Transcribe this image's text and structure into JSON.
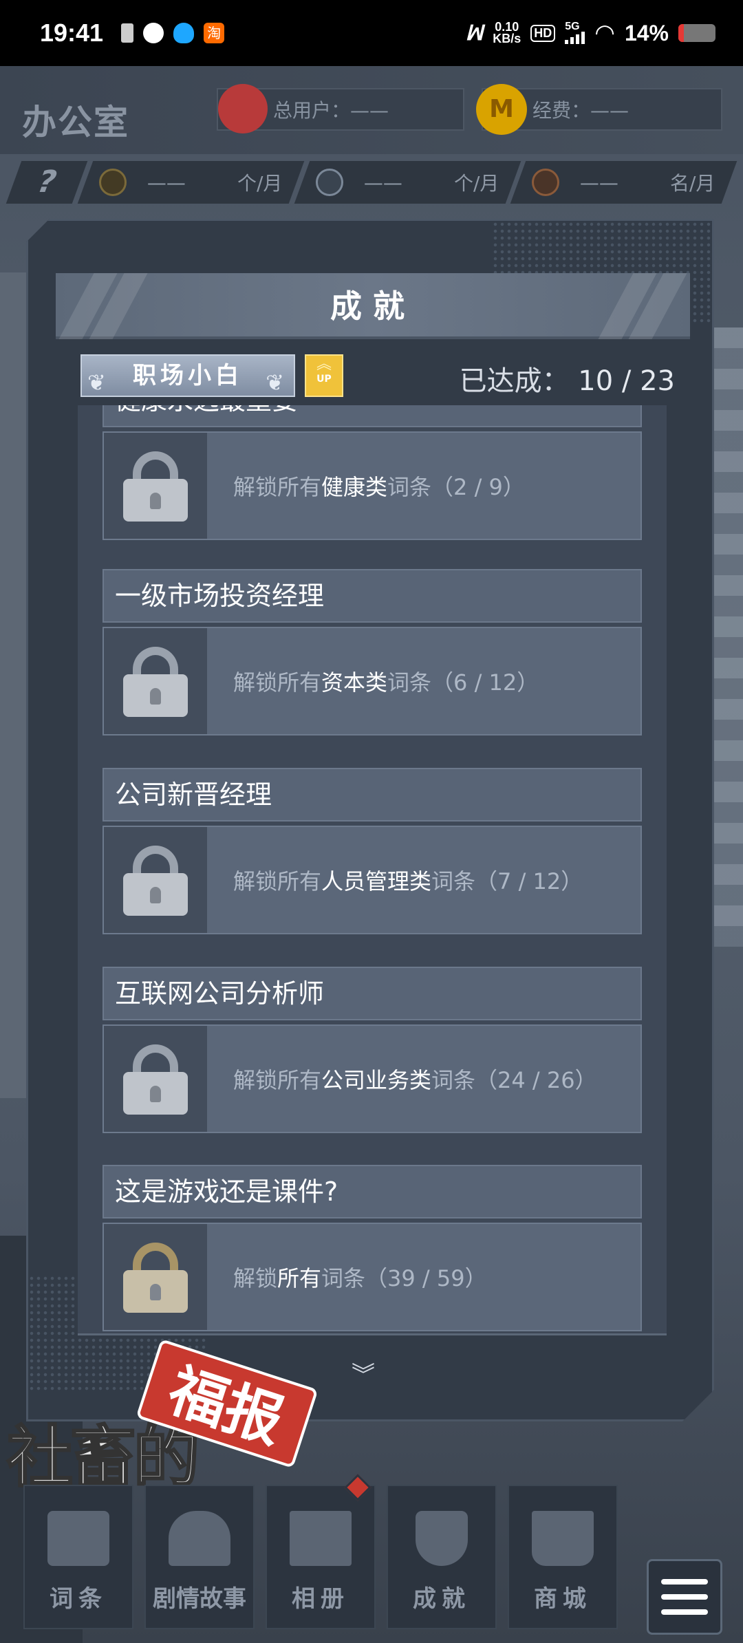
{
  "status": {
    "time": "19:41",
    "net_speed_value": "0.10",
    "net_speed_unit": "KB/s",
    "hd": "HD",
    "signal": "5G",
    "battery_pct": "14%",
    "battery_level": 0.14,
    "taobao_char": "淘"
  },
  "header": {
    "room_title": "办公室",
    "users_label": "总用户：——",
    "fee_label": "经费：——",
    "coin_glyph": "M"
  },
  "subbar": {
    "help": "?",
    "cells": [
      {
        "value": "——",
        "unit": "个/月"
      },
      {
        "value": "——",
        "unit": "个/月"
      },
      {
        "value": "——",
        "unit": "名/月"
      }
    ]
  },
  "modal": {
    "title": "成就",
    "rank": "职场小白",
    "up_label": "UP",
    "achieved_label": "已达成：",
    "achieved_count": "10 / 23",
    "items": [
      {
        "title": "健康永远最重要",
        "desc_prefix": "解锁所有",
        "desc_highlight": "健康类",
        "desc_suffix": "词条（2 / 9）",
        "lock": "silver"
      },
      {
        "title": "一级市场投资经理",
        "desc_prefix": "解锁所有",
        "desc_highlight": "资本类",
        "desc_suffix": "词条（6 / 12）",
        "lock": "silver"
      },
      {
        "title": "公司新晋经理",
        "desc_prefix": "解锁所有",
        "desc_highlight": "人员管理类",
        "desc_suffix": "词条（7 / 12）",
        "lock": "silver"
      },
      {
        "title": "互联网公司分析师",
        "desc_prefix": "解锁所有",
        "desc_highlight": "公司业务类",
        "desc_suffix": "词条（24 / 26）",
        "lock": "silver"
      },
      {
        "title": "这是游戏还是课件?",
        "desc_prefix": "解锁",
        "desc_highlight": "所有",
        "desc_suffix": "词条（39 / 59）",
        "lock": "gold"
      }
    ],
    "more_arrow": "︾"
  },
  "logo": {
    "left_text": "社畜的",
    "stamp_text": "福报"
  },
  "nav": [
    {
      "label": "词条",
      "icon": "notebook-icon"
    },
    {
      "label": "剧情故事",
      "icon": "book-icon"
    },
    {
      "label": "相册",
      "icon": "photo-icon"
    },
    {
      "label": "成就",
      "icon": "trophy-icon"
    },
    {
      "label": "商城",
      "icon": "cart-icon"
    }
  ],
  "colors": {
    "accent_gold": "#f0c23a",
    "stamp_red": "#c8392f",
    "panel": "#323b47"
  }
}
